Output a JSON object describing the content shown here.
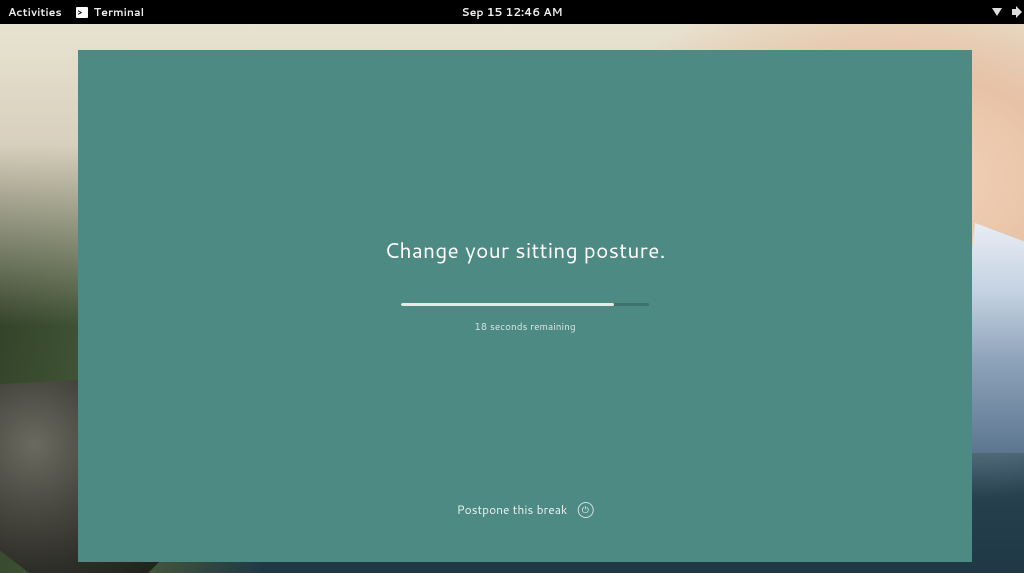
{
  "topbar": {
    "activities": "Activities",
    "app_label": "Terminal",
    "clock": "Sep 15  12:46 AM"
  },
  "break": {
    "message": "Change your sitting posture.",
    "remaining_text": "18 seconds remaining",
    "postpone_label": "Postpone this break",
    "progress_percent": 86
  }
}
